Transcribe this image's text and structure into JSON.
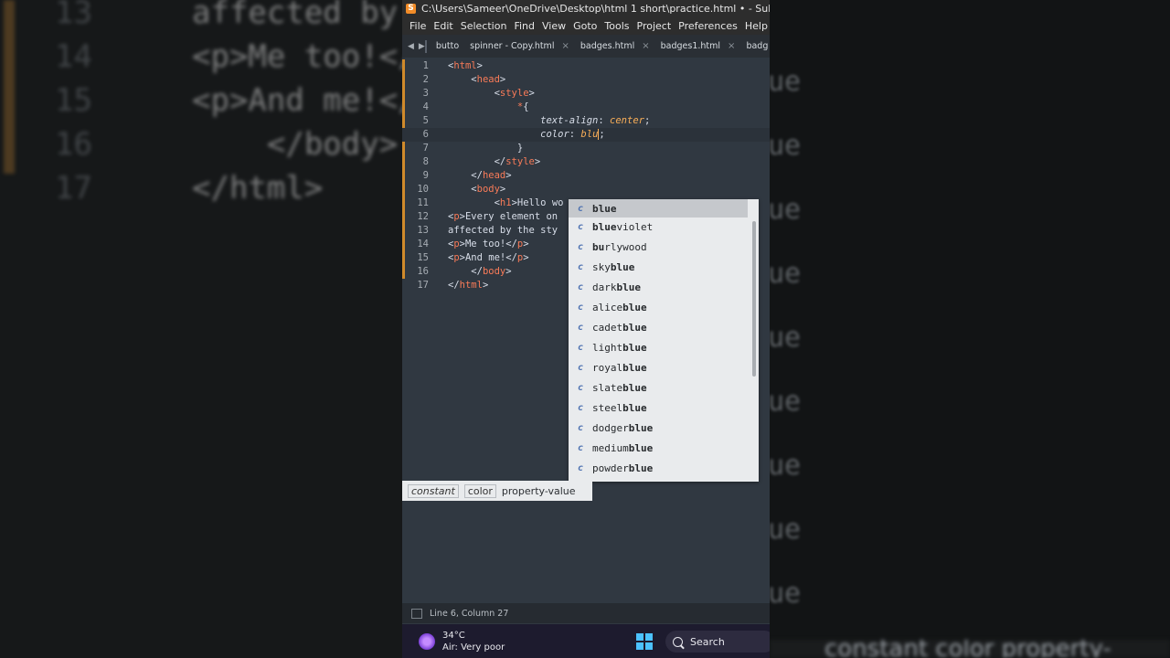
{
  "background": {
    "code_lines": [
      {
        "num": "13",
        "text": "affected by t"
      },
      {
        "num": "14",
        "text": "<p>Me too!</p>"
      },
      {
        "num": "15",
        "text": "<p>And me!</p>"
      },
      {
        "num": "16",
        "text": "    </body>"
      },
      {
        "num": "17",
        "text": "</html>"
      }
    ],
    "right_suffix": "ue",
    "bottom_text": "constant  color  property-value"
  },
  "window": {
    "title": "C:\\Users\\Sameer\\OneDrive\\Desktop\\html 1 short\\practice.html • - Sublime Text (UNREGISTERED)",
    "menu": [
      "File",
      "Edit",
      "Selection",
      "Find",
      "View",
      "Goto",
      "Tools",
      "Project",
      "Preferences",
      "Help"
    ],
    "tabs": [
      {
        "label": "butto",
        "close": ""
      },
      {
        "label": "spinner - Copy.html",
        "close": "×"
      },
      {
        "label": "badges.html",
        "close": "×"
      },
      {
        "label": "badges1.html",
        "close": "×"
      },
      {
        "label": "badg",
        "close": ""
      }
    ],
    "accent": "#f28c28"
  },
  "editor": {
    "lines": [
      {
        "num": "1",
        "code": "<html>"
      },
      {
        "num": "2",
        "code": "    <head>"
      },
      {
        "num": "3",
        "code": "        <style>"
      },
      {
        "num": "4",
        "code": "            *{"
      },
      {
        "num": "5",
        "code": "                text-align: center;"
      },
      {
        "num": "6",
        "code": "                color: blu;"
      },
      {
        "num": "7",
        "code": "            }"
      },
      {
        "num": "8",
        "code": "        </style>"
      },
      {
        "num": "9",
        "code": "    </head>"
      },
      {
        "num": "10",
        "code": "    <body>"
      },
      {
        "num": "11",
        "code": "        <h1>Hello wo"
      },
      {
        "num": "12",
        "code": "<p>Every element on"
      },
      {
        "num": "13",
        "code": "affected by the sty"
      },
      {
        "num": "14",
        "code": "<p>Me too!</p>"
      },
      {
        "num": "15",
        "code": "<p>And me!</p>"
      },
      {
        "num": "16",
        "code": "    </body>"
      },
      {
        "num": "17",
        "code": "</html>"
      }
    ],
    "active_line": "6"
  },
  "autocomplete": {
    "items": [
      {
        "kind": "c",
        "label": "blue"
      },
      {
        "kind": "c",
        "label": "blueviolet"
      },
      {
        "kind": "c",
        "label": "burlywood"
      },
      {
        "kind": "c",
        "label": "skyblue"
      },
      {
        "kind": "c",
        "label": "darkblue"
      },
      {
        "kind": "c",
        "label": "aliceblue"
      },
      {
        "kind": "c",
        "label": "cadetblue"
      },
      {
        "kind": "c",
        "label": "lightblue"
      },
      {
        "kind": "c",
        "label": "royalblue"
      },
      {
        "kind": "c",
        "label": "slateblue"
      },
      {
        "kind": "c",
        "label": "steelblue"
      },
      {
        "kind": "c",
        "label": "dodgerblue"
      },
      {
        "kind": "c",
        "label": "mediumblue"
      },
      {
        "kind": "c",
        "label": "powderblue"
      }
    ],
    "footer": {
      "kind": "constant",
      "type": "color",
      "desc": "property-value"
    }
  },
  "statusbar": {
    "position": "Line 6, Column 27"
  },
  "taskbar": {
    "temperature": "34°C",
    "air": "Air: Very poor",
    "search_label": "Search"
  }
}
